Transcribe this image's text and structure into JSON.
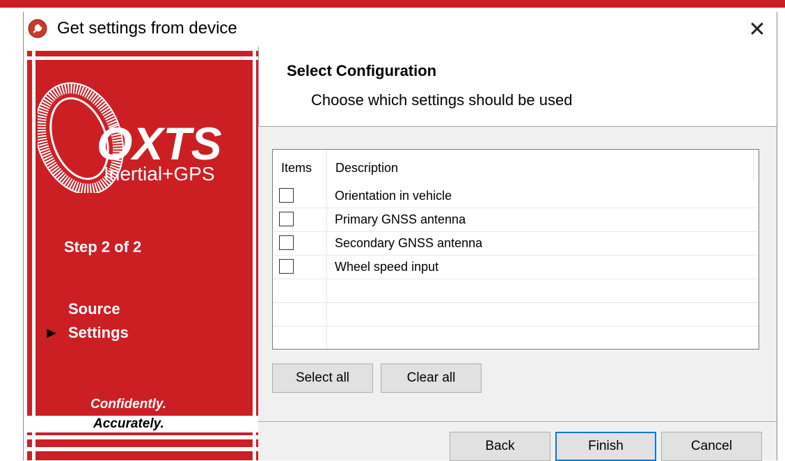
{
  "window": {
    "title": "Get settings from device",
    "close_glyph": "✕"
  },
  "brand": {
    "logo_text": "OXTS",
    "logo_subtext": "Inertial+GPS",
    "step_text": "Step 2 of 2",
    "nav": [
      {
        "label": "Source",
        "active": false
      },
      {
        "label": "Settings",
        "active": true
      }
    ],
    "active_marker": "►",
    "tagline_1": "Confidently.",
    "tagline_2": "Accurately.",
    "accent_color": "#cc1f24"
  },
  "header": {
    "title": "Select Configuration",
    "subtitle": "Choose which settings should be used"
  },
  "list": {
    "columns": [
      "Items",
      "Description"
    ],
    "rows": [
      {
        "checked": false,
        "description": "Orientation in vehicle"
      },
      {
        "checked": false,
        "description": "Primary GNSS antenna"
      },
      {
        "checked": false,
        "description": "Secondary GNSS antenna"
      },
      {
        "checked": false,
        "description": "Wheel speed input"
      }
    ]
  },
  "buttons": {
    "select_all": "Select all",
    "clear_all": "Clear all",
    "back": "Back",
    "finish": "Finish",
    "cancel": "Cancel"
  }
}
